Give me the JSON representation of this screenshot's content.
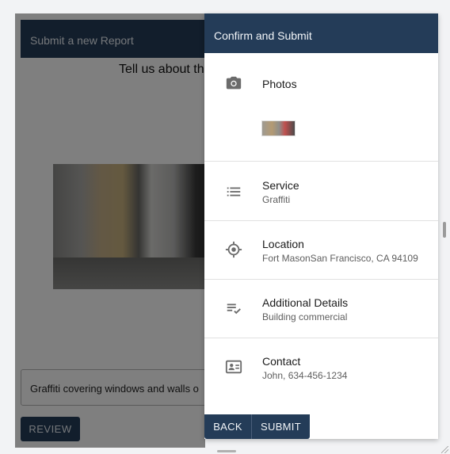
{
  "background_form": {
    "header_title": "Submit a new Report",
    "heading": "Tell us about th",
    "description_value": "Graffiti covering windows and walls o",
    "review_button": "REVIEW"
  },
  "dialog": {
    "title": "Confirm and Submit",
    "photos_label": "Photos",
    "service": {
      "label": "Service",
      "value": "Graffiti"
    },
    "location": {
      "label": "Location",
      "value": "Fort MasonSan Francisco, CA 94109"
    },
    "details": {
      "label": "Additional Details",
      "value": "Building commercial"
    },
    "contact": {
      "label": "Contact",
      "value": "John, 634-456-1234"
    },
    "back_button": "BACK",
    "submit_button": "SUBMIT"
  },
  "icons": {
    "photos": "camera-icon",
    "service": "list-icon",
    "location": "crosshair-icon",
    "details": "checklist-icon",
    "contact": "contact-card-icon"
  },
  "colors": {
    "header": "#243c58",
    "overlay": "rgba(0,0,0,0.5)"
  }
}
